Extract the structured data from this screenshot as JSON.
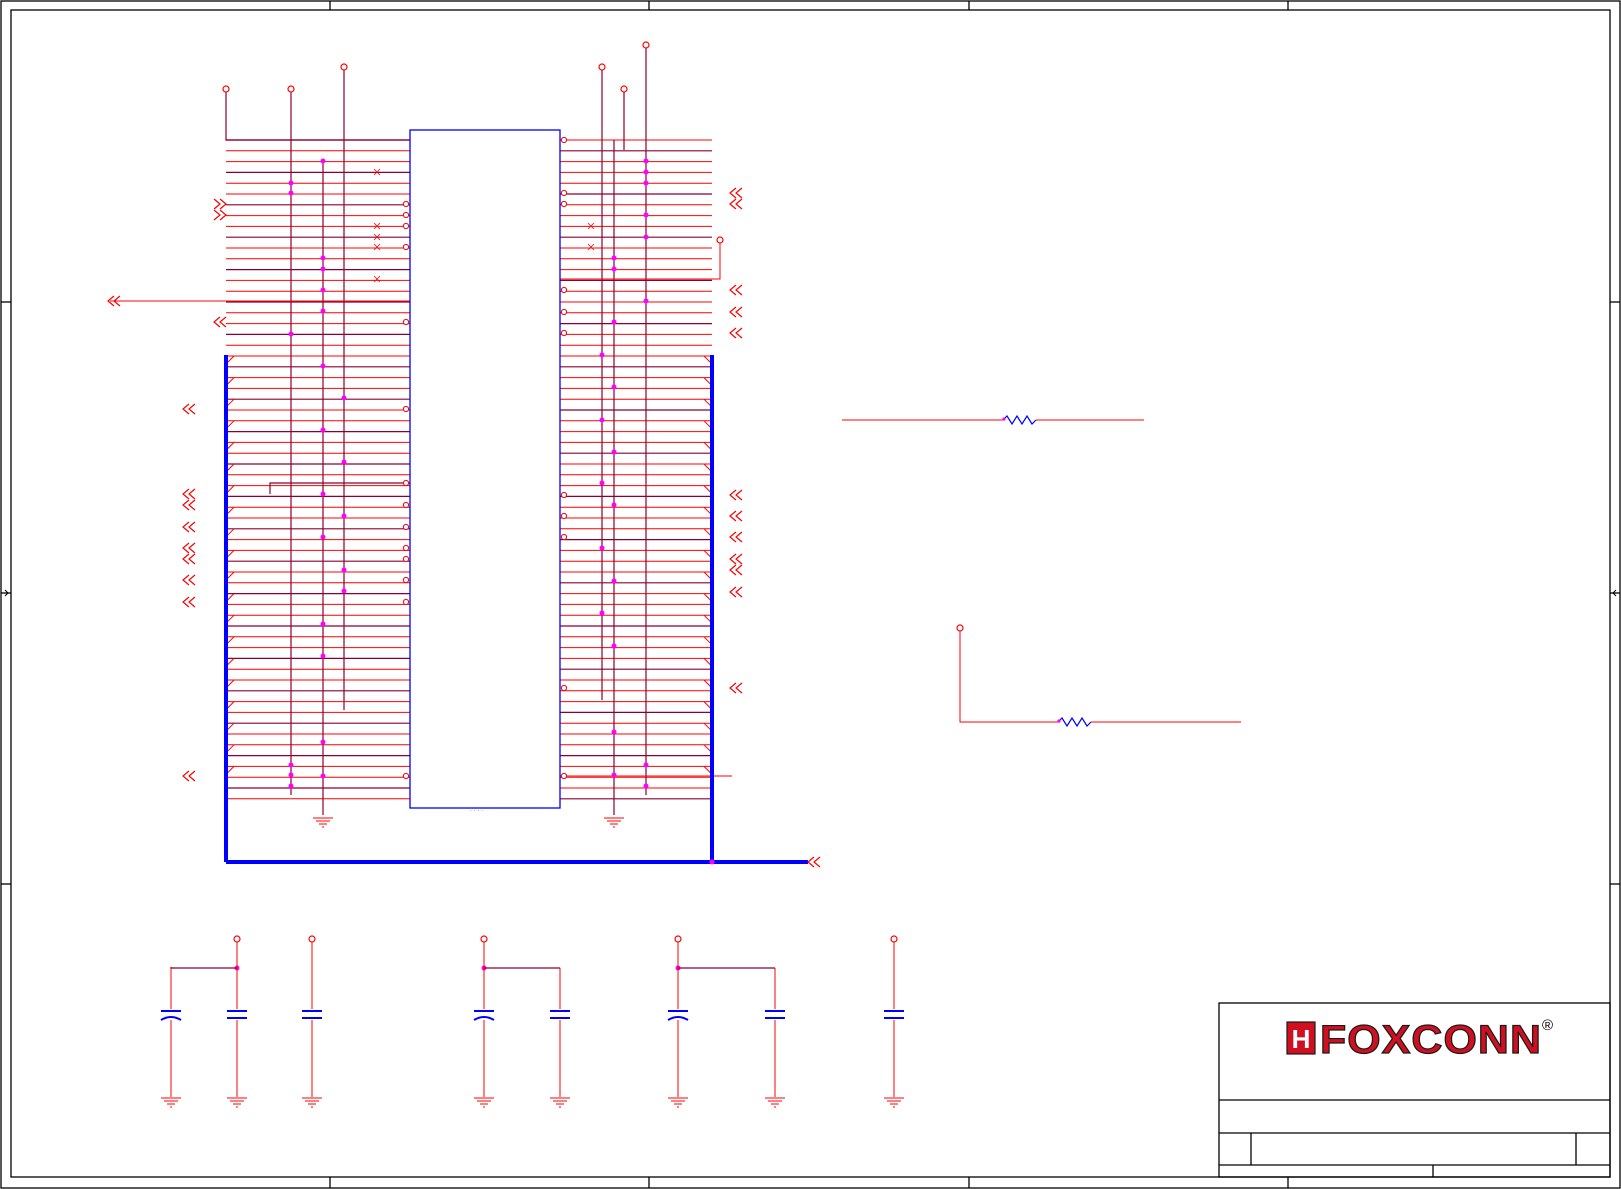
{
  "title_block": {
    "logo_text": "FOXCONN",
    "logo_mark": "H",
    "registered_mark": "®",
    "title": "",
    "size": "",
    "doc_number": "",
    "rev": ""
  },
  "colors": {
    "wire": "#ff0000",
    "wire_dark": "#8b0030",
    "bus": "#0000ff",
    "junction": "#ff00ff",
    "component_body": "#0000ff",
    "logo_red": "#d01020"
  },
  "icons": {
    "power_port": "vcc-port-icon",
    "ground": "ground-icon",
    "offpage_connector": "offpage-arrow-icon",
    "capacitor": "capacitor-icon",
    "resistor": "resistor-icon",
    "no_connect": "no-connect-icon"
  }
}
